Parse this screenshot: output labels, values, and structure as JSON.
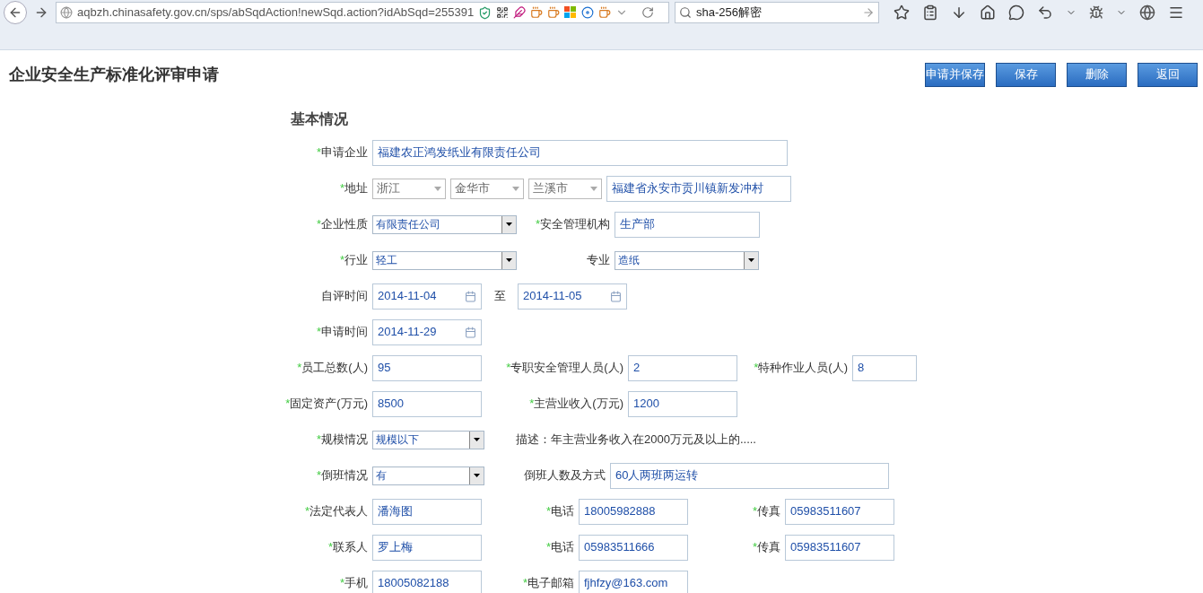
{
  "browser": {
    "url": "aqbzh.chinasafety.gov.cn/sps/abSqdAction!newSqd.action?idAbSqd=255391",
    "search": "sha-256解密"
  },
  "page": {
    "title": "企业安全生产标准化评审申请",
    "buttons": [
      "申请并保存",
      "保存",
      "删除",
      "返回"
    ]
  },
  "section": {
    "title": "基本情况"
  },
  "rows": [
    [
      {
        "kind": "label",
        "text": "申请企业",
        "asterisk": "*"
      },
      {
        "kind": "input",
        "value": "福建农正鸿发纸业有限责任公司"
      }
    ],
    [
      {
        "kind": "label",
        "text": "地址",
        "asterisk": "*"
      },
      {
        "kind": "combo",
        "value": "浙江"
      },
      {
        "kind": "combo",
        "value": "金华市"
      },
      {
        "kind": "combo",
        "value": "兰溪市"
      },
      {
        "kind": "input",
        "value": "福建省永安市贡川镇新发冲村"
      }
    ],
    [
      {
        "kind": "label",
        "text": "企业性质",
        "asterisk": "*"
      },
      {
        "kind": "select",
        "value": "有限责任公司"
      },
      {
        "kind": "label",
        "text": "安全管理机构",
        "asterisk": "*"
      },
      {
        "kind": "input",
        "value": "生产部"
      }
    ],
    [
      {
        "kind": "label",
        "text": "行业",
        "asterisk": "*"
      },
      {
        "kind": "select",
        "value": "轻工"
      },
      {
        "kind": "label",
        "text": "专业"
      },
      {
        "kind": "select",
        "value": "造纸"
      }
    ],
    [
      {
        "kind": "label",
        "text": "自评时间"
      },
      {
        "kind": "date",
        "value": "2014-11-04"
      },
      {
        "kind": "sep",
        "text": "至"
      },
      {
        "kind": "date",
        "value": "2014-11-05"
      }
    ],
    [
      {
        "kind": "label",
        "text": "申请时间",
        "asterisk": "*"
      },
      {
        "kind": "date",
        "value": "2014-11-29"
      }
    ],
    [
      {
        "kind": "label",
        "text": "员工总数(人)",
        "asterisk": "*"
      },
      {
        "kind": "input",
        "value": "95"
      },
      {
        "kind": "label",
        "text": "专职安全管理人员(人)",
        "asterisk": "*"
      },
      {
        "kind": "input",
        "value": "2"
      },
      {
        "kind": "label",
        "text": "特种作业人员(人)",
        "asterisk": "*"
      },
      {
        "kind": "input",
        "value": "8"
      }
    ],
    [
      {
        "kind": "label",
        "text": "固定资产(万元)",
        "asterisk": "*"
      },
      {
        "kind": "input",
        "value": "8500"
      },
      {
        "kind": "label",
        "text": "主营业收入(万元)",
        "asterisk": "*"
      },
      {
        "kind": "input",
        "value": "1200"
      }
    ],
    [
      {
        "kind": "label",
        "text": "规模情况",
        "asterisk": "*"
      },
      {
        "kind": "select",
        "value": "规模以下"
      },
      {
        "kind": "note",
        "text": "描述：年主营业务收入在2000万元及以上的....."
      }
    ],
    [
      {
        "kind": "label",
        "text": "倒班情况",
        "asterisk": "*"
      },
      {
        "kind": "select",
        "value": "有"
      },
      {
        "kind": "label",
        "text": "倒班人数及方式"
      },
      {
        "kind": "input",
        "value": "60人两班两运转"
      }
    ],
    [
      {
        "kind": "label",
        "text": "法定代表人",
        "asterisk": "*"
      },
      {
        "kind": "input",
        "value": "潘海图"
      },
      {
        "kind": "label",
        "text": "电话",
        "asterisk": "*"
      },
      {
        "kind": "input",
        "value": "18005982888"
      },
      {
        "kind": "label",
        "text": "传真",
        "asterisk": "*"
      },
      {
        "kind": "input",
        "value": "05983511607"
      }
    ],
    [
      {
        "kind": "label",
        "text": "联系人",
        "asterisk": "*"
      },
      {
        "kind": "input",
        "value": "罗上梅"
      },
      {
        "kind": "label",
        "text": "电话",
        "asterisk": "*"
      },
      {
        "kind": "input",
        "value": "05983511666"
      },
      {
        "kind": "label",
        "text": "传真",
        "asterisk": "*"
      },
      {
        "kind": "input",
        "value": "05983511607"
      }
    ],
    [
      {
        "kind": "label",
        "text": "手机",
        "asterisk": "*"
      },
      {
        "kind": "input",
        "value": "18005082188"
      },
      {
        "kind": "label",
        "text": "电子邮箱",
        "asterisk": "*"
      },
      {
        "kind": "input",
        "value": "fjhfzy@163.com"
      }
    ]
  ]
}
